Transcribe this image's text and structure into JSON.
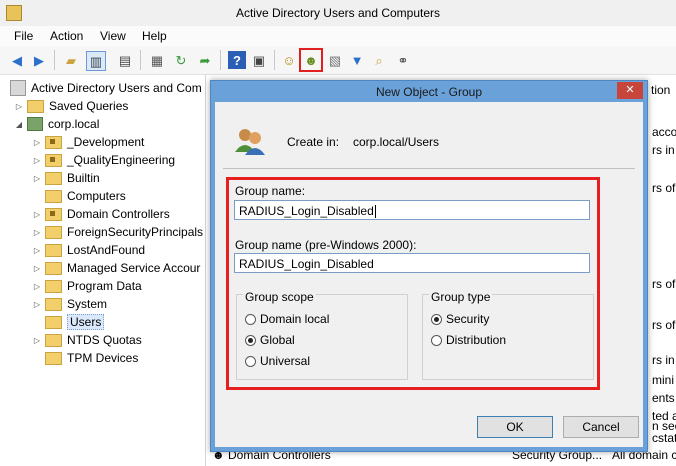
{
  "window": {
    "title": "Active Directory Users and Computers"
  },
  "menu": [
    "File",
    "Action",
    "View",
    "Help"
  ],
  "toolbar": {
    "icons": [
      "back-arrow-icon",
      "forward-arrow-icon",
      "up-folder-icon",
      "show-tree-icon",
      "properties-icon",
      "export-list-icon",
      "refresh-icon",
      "help-icon",
      "action-pane-icon",
      "new-user-icon",
      "new-group-icon",
      "new-ou-icon",
      "filter-icon",
      "find-icon",
      "add-to-group-icon"
    ],
    "highlighted": "new-group-icon"
  },
  "tree": {
    "root": "Active Directory Users and Com",
    "items": [
      {
        "label": "Saved Queries"
      },
      {
        "label": "corp.local"
      },
      {
        "label": "_Development"
      },
      {
        "label": "_QualityEngineering"
      },
      {
        "label": "Builtin"
      },
      {
        "label": "Computers"
      },
      {
        "label": "Domain Controllers"
      },
      {
        "label": "ForeignSecurityPrincipals"
      },
      {
        "label": "LostAndFound"
      },
      {
        "label": "Managed Service Accour"
      },
      {
        "label": "Program Data"
      },
      {
        "label": "System"
      },
      {
        "label": "Users"
      },
      {
        "label": "NTDS Quotas"
      },
      {
        "label": "TPM Devices"
      }
    ]
  },
  "right_pane": {
    "header_fragment": "tion",
    "fragments": [
      "acco",
      "rs in the",
      "rs of",
      "rs of",
      "rs of",
      "rs in th",
      "mini",
      "ents w",
      "ted a",
      "n seci",
      "cstatic"
    ],
    "bottom_row": {
      "name": "Domain Controllers",
      "type": "Security Group...",
      "desc": "All domain c"
    }
  },
  "dialog": {
    "title": "New Object - Group",
    "close": "✕",
    "create_in_label": "Create in:",
    "create_in_path": "corp.local/Users",
    "group_name_label": "Group name:",
    "group_name_value": "RADIUS_Login_Disabled",
    "group_name_pre2000_label": "Group name (pre-Windows 2000):",
    "group_name_pre2000_value": "RADIUS_Login_Disabled",
    "group_scope": {
      "label": "Group scope",
      "options": [
        "Domain local",
        "Global",
        "Universal"
      ],
      "selected": "Global"
    },
    "group_type": {
      "label": "Group type",
      "options": [
        "Security",
        "Distribution"
      ],
      "selected": "Security"
    },
    "ok": "OK",
    "cancel": "Cancel"
  }
}
